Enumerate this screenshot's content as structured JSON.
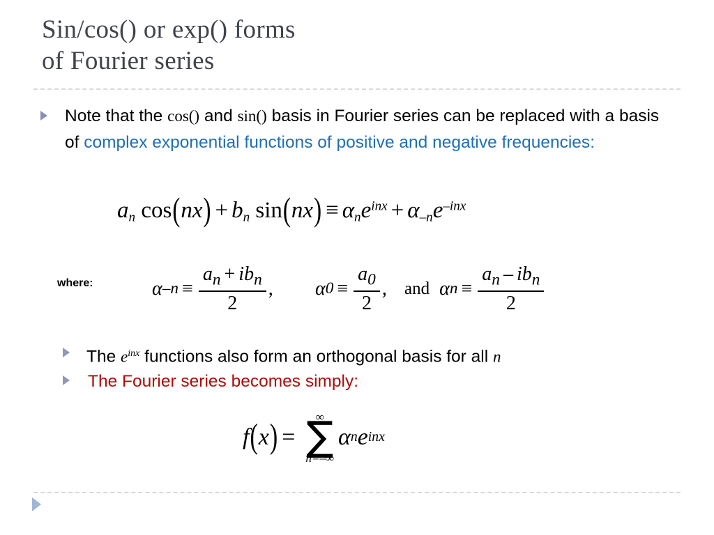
{
  "slide": {
    "title": "Sin/cos() or exp() forms\nof Fourier series",
    "background_color": "#ffffff",
    "title_color": "#41444b",
    "accent_blue": "#1f6fb5",
    "accent_red": "#b00a0a",
    "bullet_color": "#8b8fb5",
    "divider_color": "#d6d8dc"
  },
  "bullet1": {
    "part1": "Note that the ",
    "cos": "cos()",
    "part2": " and ",
    "sin": "sin()",
    "part3": " basis in Fourier series can be replaced with a basis of ",
    "highlight": "complex exponential functions of positive and negative frequencies",
    "part4": ":"
  },
  "equation1": {
    "a": "a",
    "a_sub": "n",
    "cos": "cos",
    "open1": "(",
    "nx1": "nx",
    "close1": ")",
    "plus": "+",
    "b": "b",
    "b_sub": "n",
    "sin": "sin",
    "open2": "(",
    "nx2": "nx",
    "close2": ")",
    "equiv": "≡",
    "alpha1": "α",
    "alpha1_sub": "n",
    "e1": "e",
    "e1_sup": "inx",
    "plus2": "+",
    "alpha2": "α",
    "alpha2_sub": "–n",
    "e2": "e",
    "e2_sup": "–inx"
  },
  "where_row": {
    "label": "where:",
    "def1": {
      "alpha": "α",
      "alpha_sub": "–n",
      "equiv": "≡",
      "numerator_a": "a",
      "numerator_a_sub": "n",
      "numerator_op": "+",
      "numerator_ib": "ib",
      "numerator_ib_sub": "n",
      "denominator": "2",
      "comma": ","
    },
    "def2": {
      "alpha": "α",
      "alpha_sub": "0",
      "equiv": "≡",
      "numerator_a": "a",
      "numerator_a_sub": "0",
      "denominator": "2",
      "comma": ","
    },
    "and": "and",
    "def3": {
      "alpha": "α",
      "alpha_sub": "n",
      "equiv": "≡",
      "numerator_a": "a",
      "numerator_a_sub": "n",
      "numerator_op": "–",
      "numerator_ib": "ib",
      "numerator_ib_sub": "n",
      "denominator": "2"
    }
  },
  "bullet2": {
    "part1": "The ",
    "e": "e",
    "e_sup": "inx",
    "part2": " functions also form an orthogonal basis for all ",
    "n": "n"
  },
  "bullet3": {
    "text": "The Fourier series becomes simply:"
  },
  "equation2": {
    "f": "f",
    "open": "(",
    "x": "x",
    "close": ")",
    "equals": "=",
    "sum_top": "∞",
    "sigma": "∑",
    "sum_bottom": "n=–∞",
    "alpha": "α",
    "alpha_sub": "n",
    "e": "e",
    "e_sup": "inx"
  }
}
